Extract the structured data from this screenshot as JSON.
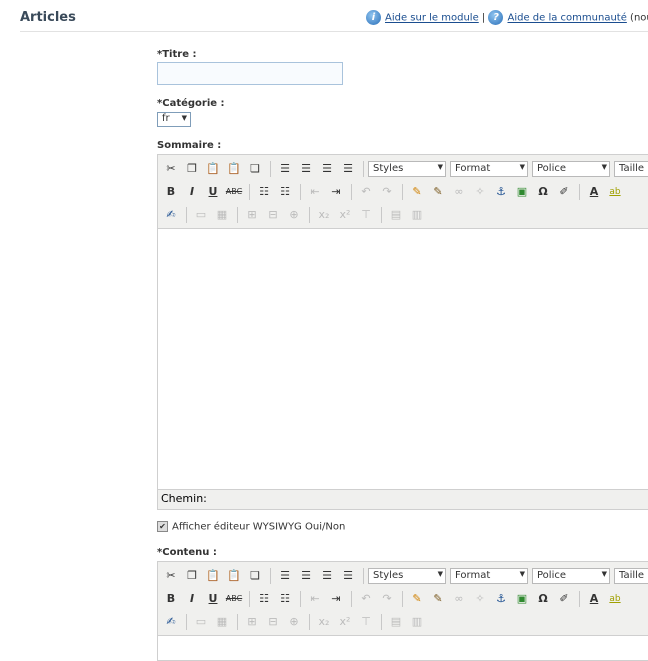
{
  "header": {
    "title": "Articles",
    "help_module": "Aide sur le module",
    "separator": "|",
    "help_community": "Aide de la communauté",
    "help_community_suffix": "(nouve"
  },
  "form": {
    "titre_label": "*Titre :",
    "titre_value": "",
    "categorie_label": "*Catégorie :",
    "categorie_value": "fr",
    "sommaire_label": "Sommaire :",
    "wysiwyg_checkbox": "Afficher éditeur WYSIWYG Oui/Non",
    "wysiwyg_checked": true,
    "contenu_label": "*Contenu :"
  },
  "editor": {
    "styles": "Styles",
    "format": "Format",
    "police": "Police",
    "taille": "Taille p",
    "path_label": "Chemin:"
  }
}
